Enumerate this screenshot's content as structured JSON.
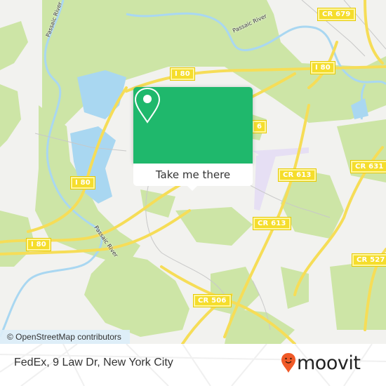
{
  "map": {
    "attribution": "© OpenStreetMap contributors",
    "road_shields": [
      {
        "label": "CR 679"
      },
      {
        "label": "I 80"
      },
      {
        "label": "I 80"
      },
      {
        "label": "I 80"
      },
      {
        "label": "I 80"
      },
      {
        "label": "CR 613"
      },
      {
        "label": "CR 613"
      },
      {
        "label": "CR 631"
      },
      {
        "label": "CR 527"
      },
      {
        "label": "CR 506"
      },
      {
        "label": "6"
      }
    ],
    "water_labels": [
      {
        "label": "Passaic River"
      },
      {
        "label": "Passaic River"
      },
      {
        "label": "Passaic River"
      }
    ],
    "colors": {
      "land": "#f2f2ef",
      "park": "#cde5a6",
      "water": "#a9d7f1",
      "road": "#f6dd57",
      "airport": "#e8e2f2"
    }
  },
  "popup": {
    "button_label": "Take me there",
    "icon": "map-pin-icon",
    "accent": "#1fb86c"
  },
  "footer": {
    "place_name": "FedEx, 9 Law Dr, New York City",
    "brand": "moovit",
    "brand_color": "#f05a28"
  }
}
